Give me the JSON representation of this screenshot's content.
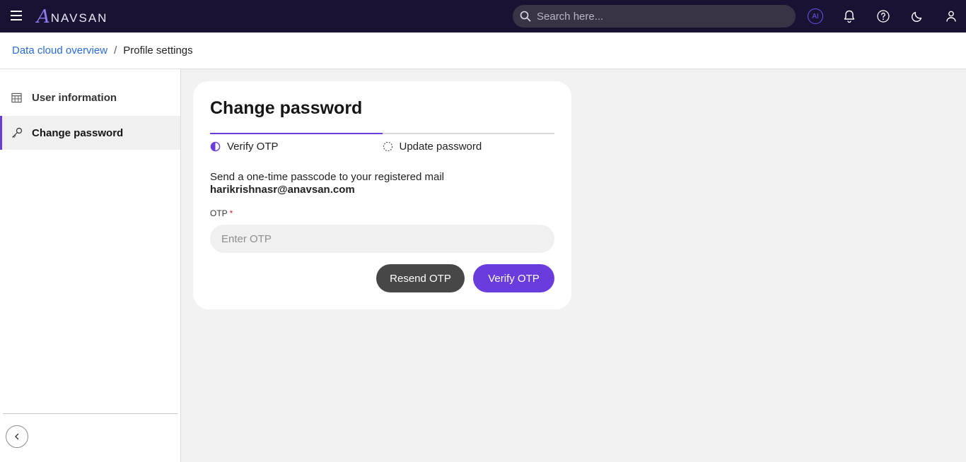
{
  "app": {
    "logo_letter": "A",
    "logo_rest": "NAVSAN",
    "menu_icon": "hamburger-icon"
  },
  "search": {
    "placeholder": "Search here..."
  },
  "top_icons": {
    "ai_label": "AI",
    "items": [
      "ai-icon",
      "bell-icon",
      "help-icon",
      "moon-icon",
      "user-icon"
    ]
  },
  "breadcrumb": {
    "link": "Data cloud overview",
    "separator": "/",
    "current": "Profile settings"
  },
  "sidebar": {
    "items": [
      {
        "label": "User information",
        "icon": "calendar-icon",
        "active": false
      },
      {
        "label": "Change password",
        "icon": "key-icon",
        "active": true
      }
    ],
    "collapse_icon": "chevron-left-icon"
  },
  "card": {
    "title": "Change password",
    "steps": [
      {
        "label": "Verify OTP",
        "state": "current"
      },
      {
        "label": "Update password",
        "state": "incomplete"
      }
    ],
    "description": "Send a one-time passcode to your registered mail",
    "email": "harikrishnasr@anavsan.com",
    "otp_label": "OTP",
    "otp_required_mark": "*",
    "otp_placeholder": "Enter OTP",
    "otp_value": "",
    "resend_button": "Resend OTP",
    "verify_button": "Verify OTP"
  },
  "colors": {
    "topbar": "#1a1233",
    "accent": "#6a3cdd",
    "link": "#2a6bdb",
    "secondary_button": "#474747"
  }
}
